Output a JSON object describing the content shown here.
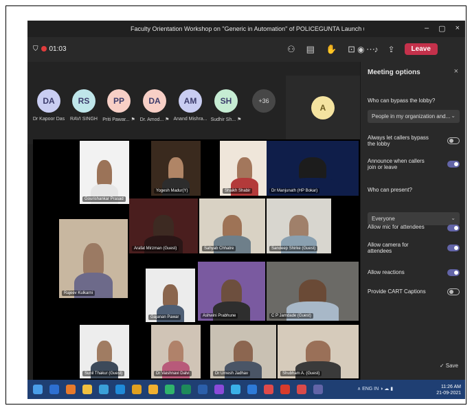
{
  "window": {
    "title": "Faculty Orientation Workshop on \"Generic in Automation\" of POLICEGUNTA Launch under the aegis of EDC/DUS/T&RD | MPV",
    "minimize": "–",
    "maximize": "▢",
    "close": "×"
  },
  "toolbar": {
    "time": "01:03",
    "leave_label": "Leave"
  },
  "participants": [
    {
      "initials": "DA",
      "name": "Dr Kapoor Das",
      "color": "#c9cdf2"
    },
    {
      "initials": "RS",
      "name": "RAVI SINGH",
      "color": "#bfe6ea"
    },
    {
      "initials": "PP",
      "name": "Priti Pawar... ⚑",
      "color": "#f7cfc6"
    },
    {
      "initials": "DA",
      "name": "Dr. Amod... ⚑",
      "color": "#f7cfc6"
    },
    {
      "initials": "AM",
      "name": "Anand Mishra...",
      "color": "#c9cdf2"
    },
    {
      "initials": "SH",
      "name": "Sudhir Sh... ⚑",
      "color": "#c6ecd3"
    }
  ],
  "more_label": "+36",
  "self_initial": "A",
  "video_tiles": [
    {
      "name": "Gourishankar Prasad",
      "bg": "#f2f2f2",
      "skin": "#9b7358",
      "shirt": "#e6e6e6"
    },
    {
      "name": "Yogesh Madur(Y)",
      "bg": "#3a2a1e",
      "skin": "#b08566",
      "shirt": "#2d2d2d"
    },
    {
      "name": "Shaikh Shabir",
      "bg": "#efe6da",
      "skin": "#a3775c",
      "shirt": "#b33a3a"
    },
    {
      "name": "Dr Manjunath (HP Bokar)",
      "bg": "#0f1e4a",
      "skin": "#1c1c1c",
      "shirt": "#0f1e4a"
    },
    {
      "name": "Rajeev Kulkarni",
      "bg": "#c8b7a0",
      "skin": "#9b7a63",
      "shirt": "#6d6a8a"
    },
    {
      "name": "Arafat Mirzman (Guest)",
      "bg": "#4a1e1e",
      "skin": "#3d2a22",
      "shirt": "#2a1616"
    },
    {
      "name": "Sahyab Chhatre",
      "bg": "#d9d2c4",
      "skin": "#9e7356",
      "shirt": "#6e7f8a"
    },
    {
      "name": "Sandeep Shirke (Guest)",
      "bg": "#d8d6cf",
      "skin": "#a0806a",
      "shirt": "#8aa0b0"
    },
    {
      "name": "Gajanan Pawar",
      "bg": "#ececec",
      "skin": "#8a654d",
      "shirt": "#4e5e74"
    },
    {
      "name": "Ashwini Prabhune",
      "bg": "#7a5aa0",
      "skin": "#6d4f3e",
      "shirt": "#2e2e2e"
    },
    {
      "name": "C P Jamdade (Guest)",
      "bg": "#6b6a66",
      "skin": "#6a4a36",
      "shirt": "#a8b8c8"
    },
    {
      "name": "Sunil Thakur (Guest)",
      "bg": "#ededed",
      "skin": "#a07c62",
      "shirt": "#3d4a5a"
    },
    {
      "name": "Dr Vaishnavi Dalvi",
      "bg": "#d0c4b6",
      "skin": "#b0826a",
      "shirt": "#b85a7a"
    },
    {
      "name": "Dr Umesh Jadhav",
      "bg": "#c9c1b3",
      "skin": "#8c6650",
      "shirt": "#4a5566"
    },
    {
      "name": "Shubham A. (Guest)",
      "bg": "#d6cbbb",
      "skin": "#9a7058",
      "shirt": "#3a3a3a"
    }
  ],
  "meeting_options": {
    "title": "Meeting options",
    "close": "×",
    "bypass_lobby_label": "Who can bypass the lobby?",
    "bypass_lobby_value": "People in my organization and...",
    "dialin_bypass_label": "Always let callers bypass the lobby",
    "dialin_bypass_on": false,
    "announce_label": "Announce when callers join or leave",
    "announce_on": true,
    "presenter_label": "Who can present?",
    "presenter_value": "Everyone",
    "mic_label": "Allow mic for attendees",
    "mic_on": true,
    "camera_label": "Allow camera for attendees",
    "camera_on": true,
    "reactions_label": "Allow reactions",
    "reactions_on": true,
    "cart_label": "Provide CART Captions",
    "cart_on": false,
    "save_label": "Save"
  },
  "taskbar": {
    "tray_text": "∧  ENG  IN  ◑  ☁  ▮",
    "time": "11:26 AM",
    "date": "21-09-2021"
  }
}
